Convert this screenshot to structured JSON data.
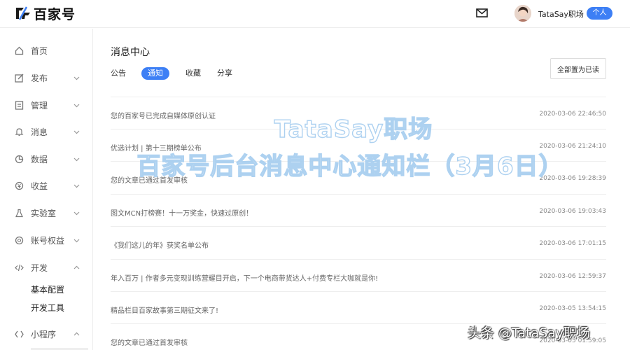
{
  "brand": {
    "logo_text": "百家号"
  },
  "header": {
    "username": "TataSay职场",
    "badge": "个人"
  },
  "sidebar": {
    "items": [
      {
        "label": "首页"
      },
      {
        "label": "发布"
      },
      {
        "label": "管理"
      },
      {
        "label": "消息"
      },
      {
        "label": "数据"
      },
      {
        "label": "收益"
      },
      {
        "label": "实验室"
      },
      {
        "label": "账号权益"
      },
      {
        "label": "开发"
      },
      {
        "label": "小程序"
      }
    ],
    "dev_subitems": [
      {
        "label": "基本配置"
      },
      {
        "label": "开发工具"
      }
    ]
  },
  "main": {
    "title": "消息中心",
    "tabs": [
      {
        "label": "公告"
      },
      {
        "label": "通知"
      },
      {
        "label": "收藏"
      },
      {
        "label": "分享"
      }
    ],
    "active_tab": "通知",
    "mark_all_read": "全部置为已读",
    "messages": [
      {
        "text": "您的百家号已完成自媒体原创认证",
        "time": "2020-03-06 22:46:50"
      },
      {
        "text": "优选计划 | 第十三期榜单公布",
        "time": "2020-03-06 21:24:10"
      },
      {
        "text": "您的文章已通过首发审核",
        "time": "2020-03-06 19:28:39"
      },
      {
        "text": "图文MCN打榜赛！十一万奖金，快速过原创！",
        "time": "2020-03-06 19:03:43"
      },
      {
        "text": "《我们这儿的年》获奖名单公布",
        "time": "2020-03-06 17:01:15"
      },
      {
        "text": "年入百万 | 作者多元变现训练营耀目开启，下一个电商带货达人+付费专栏大咖就是你!",
        "time": "2020-03-06 12:59:37"
      },
      {
        "text": "精品栏目百家故事第三期征文来了!",
        "time": "2020-03-05 13:54:15"
      },
      {
        "text": "您的文章已通过首发审核",
        "time": "2020-03-05 01:59:05"
      }
    ]
  },
  "overlay": {
    "line1": "TataSay职场",
    "line2": "百家号后台消息中心通知栏（3月6日）"
  },
  "watermark": "头条 @TataSay职场",
  "colors": {
    "accent": "#3d7ff5",
    "overlay_stroke": "#a9cff0"
  }
}
